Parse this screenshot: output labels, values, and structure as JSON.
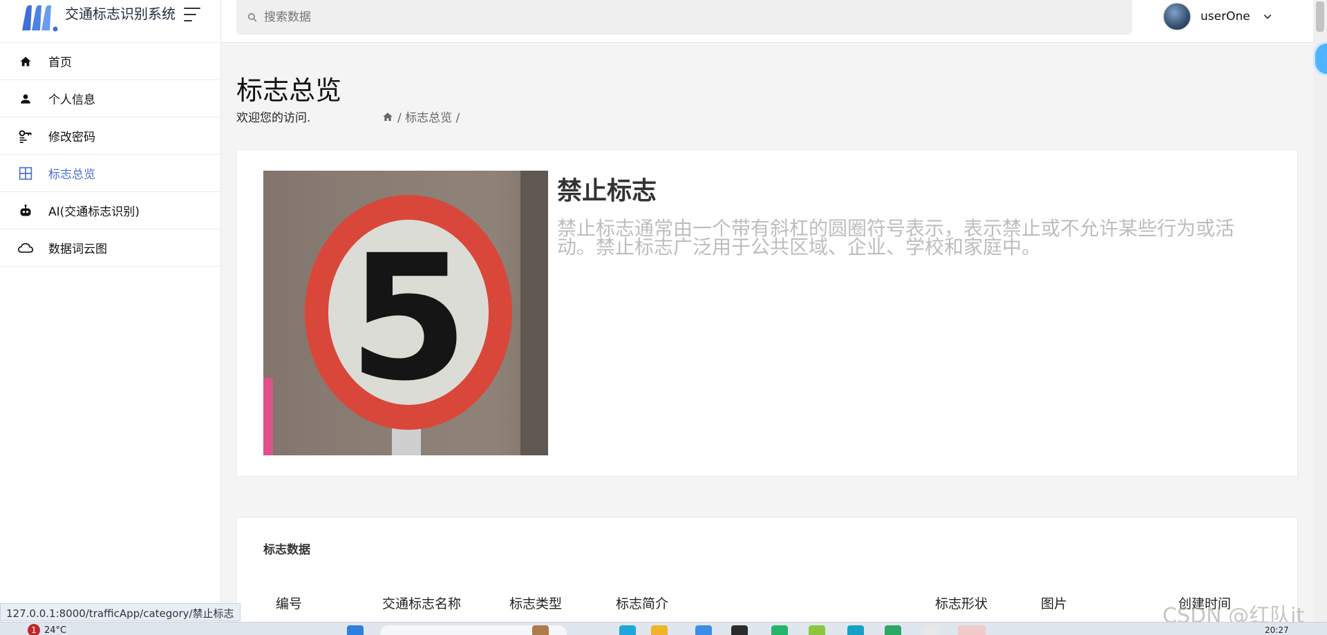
{
  "app": {
    "title": "交通标志识别系统"
  },
  "search": {
    "placeholder": "搜索数据"
  },
  "user": {
    "name": "userOne"
  },
  "sidebar": {
    "items": [
      {
        "label": "首页",
        "icon": "home-icon"
      },
      {
        "label": "个人信息",
        "icon": "person-icon"
      },
      {
        "label": "修改密码",
        "icon": "key-icon"
      },
      {
        "label": "标志总览",
        "icon": "grid-icon",
        "active": true
      },
      {
        "label": "AI(交通标志识别)",
        "icon": "robot-icon"
      },
      {
        "label": "数据词云图",
        "icon": "cloud-icon"
      }
    ]
  },
  "page": {
    "title": "标志总览",
    "welcome": "欢迎您的访问.",
    "breadcrumb": "/ 标志总览 /"
  },
  "detail": {
    "title": "禁止标志",
    "description": "禁止标志通常由一个带有斜杠的圆圈符号表示，表示禁止或不允许某些行为或活动。禁止标志广泛用于公共区域、企业、学校和家庭中。",
    "image_label": "5"
  },
  "table": {
    "title": "标志数据",
    "headers": [
      "编号",
      "交通标志名称",
      "标志类型",
      "标志简介",
      "标志形状",
      "图片",
      "创建时间"
    ]
  },
  "status": {
    "url": "127.0.0.1:8000/trafficApp/category/禁止标志"
  },
  "taskbar": {
    "weather": "24°C",
    "badge": "1",
    "time": "20:27"
  },
  "watermark": "CSDN @红队it",
  "colors": {
    "accent": "#4a6fd0",
    "sign_ring": "#d9473a",
    "bubble": "#4db5ff"
  }
}
